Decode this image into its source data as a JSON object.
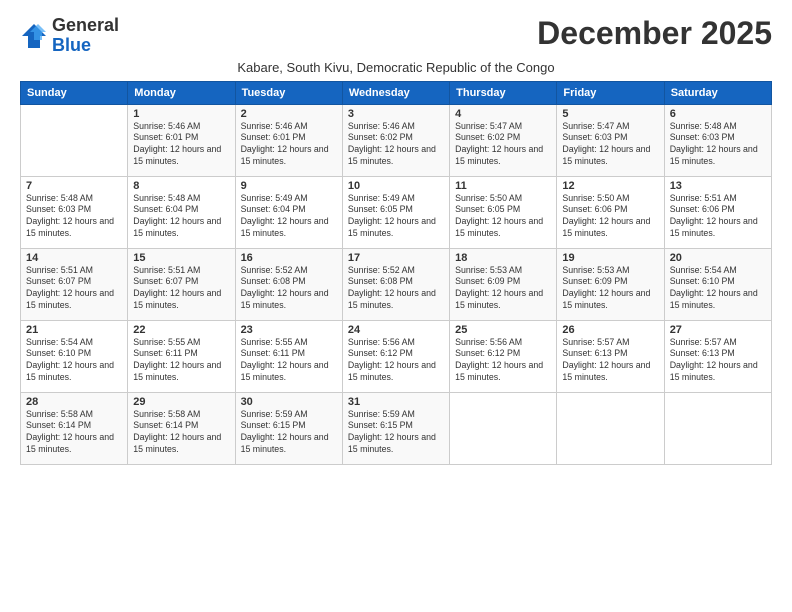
{
  "logo": {
    "general": "General",
    "blue": "Blue"
  },
  "title": "December 2025",
  "subtitle": "Kabare, South Kivu, Democratic Republic of the Congo",
  "days_of_week": [
    "Sunday",
    "Monday",
    "Tuesday",
    "Wednesday",
    "Thursday",
    "Friday",
    "Saturday"
  ],
  "weeks": [
    [
      {
        "day": "",
        "sunrise": "",
        "sunset": "",
        "daylight": ""
      },
      {
        "day": "1",
        "sunrise": "Sunrise: 5:46 AM",
        "sunset": "Sunset: 6:01 PM",
        "daylight": "Daylight: 12 hours and 15 minutes."
      },
      {
        "day": "2",
        "sunrise": "Sunrise: 5:46 AM",
        "sunset": "Sunset: 6:01 PM",
        "daylight": "Daylight: 12 hours and 15 minutes."
      },
      {
        "day": "3",
        "sunrise": "Sunrise: 5:46 AM",
        "sunset": "Sunset: 6:02 PM",
        "daylight": "Daylight: 12 hours and 15 minutes."
      },
      {
        "day": "4",
        "sunrise": "Sunrise: 5:47 AM",
        "sunset": "Sunset: 6:02 PM",
        "daylight": "Daylight: 12 hours and 15 minutes."
      },
      {
        "day": "5",
        "sunrise": "Sunrise: 5:47 AM",
        "sunset": "Sunset: 6:03 PM",
        "daylight": "Daylight: 12 hours and 15 minutes."
      },
      {
        "day": "6",
        "sunrise": "Sunrise: 5:48 AM",
        "sunset": "Sunset: 6:03 PM",
        "daylight": "Daylight: 12 hours and 15 minutes."
      }
    ],
    [
      {
        "day": "7",
        "sunrise": "Sunrise: 5:48 AM",
        "sunset": "Sunset: 6:03 PM",
        "daylight": "Daylight: 12 hours and 15 minutes."
      },
      {
        "day": "8",
        "sunrise": "Sunrise: 5:48 AM",
        "sunset": "Sunset: 6:04 PM",
        "daylight": "Daylight: 12 hours and 15 minutes."
      },
      {
        "day": "9",
        "sunrise": "Sunrise: 5:49 AM",
        "sunset": "Sunset: 6:04 PM",
        "daylight": "Daylight: 12 hours and 15 minutes."
      },
      {
        "day": "10",
        "sunrise": "Sunrise: 5:49 AM",
        "sunset": "Sunset: 6:05 PM",
        "daylight": "Daylight: 12 hours and 15 minutes."
      },
      {
        "day": "11",
        "sunrise": "Sunrise: 5:50 AM",
        "sunset": "Sunset: 6:05 PM",
        "daylight": "Daylight: 12 hours and 15 minutes."
      },
      {
        "day": "12",
        "sunrise": "Sunrise: 5:50 AM",
        "sunset": "Sunset: 6:06 PM",
        "daylight": "Daylight: 12 hours and 15 minutes."
      },
      {
        "day": "13",
        "sunrise": "Sunrise: 5:51 AM",
        "sunset": "Sunset: 6:06 PM",
        "daylight": "Daylight: 12 hours and 15 minutes."
      }
    ],
    [
      {
        "day": "14",
        "sunrise": "Sunrise: 5:51 AM",
        "sunset": "Sunset: 6:07 PM",
        "daylight": "Daylight: 12 hours and 15 minutes."
      },
      {
        "day": "15",
        "sunrise": "Sunrise: 5:51 AM",
        "sunset": "Sunset: 6:07 PM",
        "daylight": "Daylight: 12 hours and 15 minutes."
      },
      {
        "day": "16",
        "sunrise": "Sunrise: 5:52 AM",
        "sunset": "Sunset: 6:08 PM",
        "daylight": "Daylight: 12 hours and 15 minutes."
      },
      {
        "day": "17",
        "sunrise": "Sunrise: 5:52 AM",
        "sunset": "Sunset: 6:08 PM",
        "daylight": "Daylight: 12 hours and 15 minutes."
      },
      {
        "day": "18",
        "sunrise": "Sunrise: 5:53 AM",
        "sunset": "Sunset: 6:09 PM",
        "daylight": "Daylight: 12 hours and 15 minutes."
      },
      {
        "day": "19",
        "sunrise": "Sunrise: 5:53 AM",
        "sunset": "Sunset: 6:09 PM",
        "daylight": "Daylight: 12 hours and 15 minutes."
      },
      {
        "day": "20",
        "sunrise": "Sunrise: 5:54 AM",
        "sunset": "Sunset: 6:10 PM",
        "daylight": "Daylight: 12 hours and 15 minutes."
      }
    ],
    [
      {
        "day": "21",
        "sunrise": "Sunrise: 5:54 AM",
        "sunset": "Sunset: 6:10 PM",
        "daylight": "Daylight: 12 hours and 15 minutes."
      },
      {
        "day": "22",
        "sunrise": "Sunrise: 5:55 AM",
        "sunset": "Sunset: 6:11 PM",
        "daylight": "Daylight: 12 hours and 15 minutes."
      },
      {
        "day": "23",
        "sunrise": "Sunrise: 5:55 AM",
        "sunset": "Sunset: 6:11 PM",
        "daylight": "Daylight: 12 hours and 15 minutes."
      },
      {
        "day": "24",
        "sunrise": "Sunrise: 5:56 AM",
        "sunset": "Sunset: 6:12 PM",
        "daylight": "Daylight: 12 hours and 15 minutes."
      },
      {
        "day": "25",
        "sunrise": "Sunrise: 5:56 AM",
        "sunset": "Sunset: 6:12 PM",
        "daylight": "Daylight: 12 hours and 15 minutes."
      },
      {
        "day": "26",
        "sunrise": "Sunrise: 5:57 AM",
        "sunset": "Sunset: 6:13 PM",
        "daylight": "Daylight: 12 hours and 15 minutes."
      },
      {
        "day": "27",
        "sunrise": "Sunrise: 5:57 AM",
        "sunset": "Sunset: 6:13 PM",
        "daylight": "Daylight: 12 hours and 15 minutes."
      }
    ],
    [
      {
        "day": "28",
        "sunrise": "Sunrise: 5:58 AM",
        "sunset": "Sunset: 6:14 PM",
        "daylight": "Daylight: 12 hours and 15 minutes."
      },
      {
        "day": "29",
        "sunrise": "Sunrise: 5:58 AM",
        "sunset": "Sunset: 6:14 PM",
        "daylight": "Daylight: 12 hours and 15 minutes."
      },
      {
        "day": "30",
        "sunrise": "Sunrise: 5:59 AM",
        "sunset": "Sunset: 6:15 PM",
        "daylight": "Daylight: 12 hours and 15 minutes."
      },
      {
        "day": "31",
        "sunrise": "Sunrise: 5:59 AM",
        "sunset": "Sunset: 6:15 PM",
        "daylight": "Daylight: 12 hours and 15 minutes."
      },
      {
        "day": "",
        "sunrise": "",
        "sunset": "",
        "daylight": ""
      },
      {
        "day": "",
        "sunrise": "",
        "sunset": "",
        "daylight": ""
      },
      {
        "day": "",
        "sunrise": "",
        "sunset": "",
        "daylight": ""
      }
    ]
  ]
}
